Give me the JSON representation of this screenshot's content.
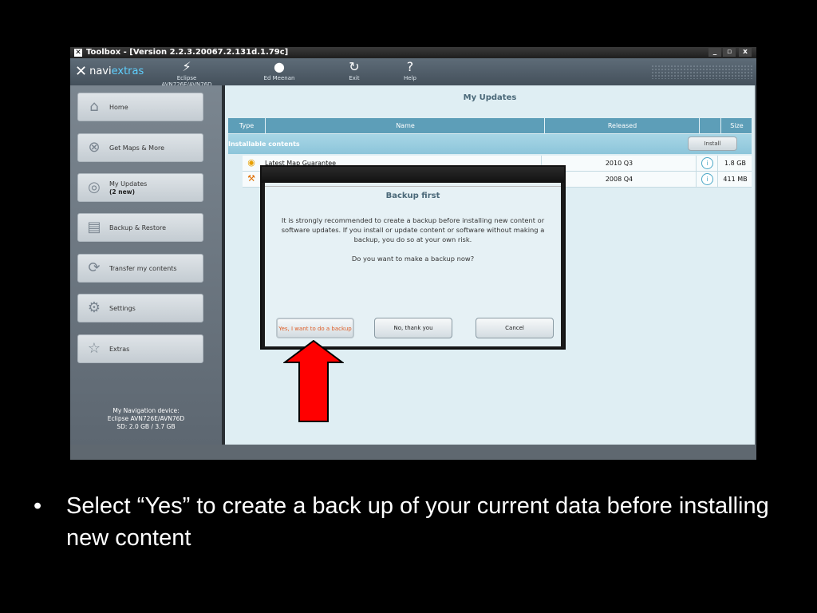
{
  "window": {
    "title": "Toolbox - [Version 2.2.3.20067.2.131d.1.79c]",
    "controls": [
      "_",
      "▫",
      "x"
    ]
  },
  "topbar": {
    "logo_a": "navi",
    "logo_b": "extras",
    "items": [
      {
        "label": "Eclipse AVN726E/AVN76D",
        "icon": "device-icon"
      },
      {
        "label": "Ed Meenan",
        "icon": "user-icon"
      },
      {
        "label": "Exit",
        "icon": "exit-icon"
      },
      {
        "label": "Help",
        "icon": "help-icon"
      }
    ]
  },
  "sidebar": {
    "items": [
      {
        "label": "Home",
        "icon": "home-icon"
      },
      {
        "label": "Get Maps & More",
        "icon": "maps-icon"
      },
      {
        "label": "My Updates",
        "sub": "(2 new)",
        "icon": "updates-icon"
      },
      {
        "label": "Backup & Restore",
        "icon": "backup-icon"
      },
      {
        "label": "Transfer my contents",
        "icon": "transfer-icon"
      },
      {
        "label": "Settings",
        "icon": "gear-icon"
      },
      {
        "label": "Extras",
        "icon": "star-icon"
      }
    ],
    "device_info": {
      "line1": "My Navigation device:",
      "line2": "Eclipse AVN726E/AVN76D",
      "line3": "SD: 2.0 GB / 3.7 GB"
    }
  },
  "main": {
    "header": "My Updates",
    "columns": {
      "type": "Type",
      "name": "Name",
      "released": "Released",
      "size": "Size"
    },
    "group": {
      "label": "Installable contents",
      "install_button": "Install"
    },
    "rows": [
      {
        "name": "Latest Map Guarantee",
        "released": "2010 Q3",
        "size": "1.8 GB"
      },
      {
        "name": "",
        "released": "2008 Q4",
        "size": "411 MB"
      }
    ]
  },
  "dialog": {
    "title": "Backup first",
    "message": "It is strongly recommended to create a backup before installing new content or software updates. If you install or update content or software without making a backup, you do so at your own risk.",
    "question": "Do you want to make a backup now?",
    "buttons": {
      "yes": "Yes, I want to do a backup",
      "no": "No, thank you",
      "cancel": "Cancel"
    }
  },
  "colors": {
    "arrow": "#ff0000",
    "accent": "#5d9eb8"
  },
  "caption": {
    "bullet": "•",
    "text": "Select “Yes” to create a back up of your current data before installing new content"
  }
}
